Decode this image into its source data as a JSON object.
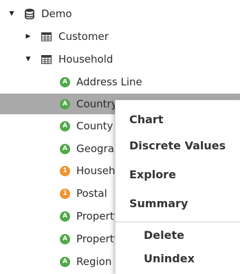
{
  "tree": {
    "root": {
      "label": "Demo",
      "icon": "database-icon",
      "expanded": true
    },
    "tables": [
      {
        "label": "Customer",
        "icon": "table-icon",
        "expanded": false
      },
      {
        "label": "Household",
        "icon": "table-icon",
        "expanded": true
      }
    ],
    "attributes": [
      {
        "label": "Address Line",
        "badge": "A",
        "color": "#51a84a"
      },
      {
        "label": "Country",
        "badge": "A",
        "color": "#51a84a",
        "selected": true
      },
      {
        "label": "County",
        "badge": "A",
        "color": "#51a84a"
      },
      {
        "label": "Geography",
        "badge": "A",
        "color": "#51a84a"
      },
      {
        "label": "Household",
        "badge": "1",
        "color": "#ef9430"
      },
      {
        "label": "Postal",
        "badge": "1",
        "color": "#ef9430"
      },
      {
        "label": "Property",
        "badge": "A",
        "color": "#51a84a"
      },
      {
        "label": "Property",
        "badge": "A",
        "color": "#51a84a"
      },
      {
        "label": "Region",
        "badge": "A",
        "color": "#51a84a"
      }
    ]
  },
  "context_menu": {
    "items": [
      {
        "label": "Chart"
      },
      {
        "label": "Discrete Values"
      },
      {
        "label": "Explore"
      },
      {
        "label": "Summary"
      }
    ],
    "secondary_items": [
      {
        "label": "Delete"
      },
      {
        "label": "Unindex"
      }
    ]
  },
  "colors": {
    "selected_row": "#a9a9a9",
    "attribute_green": "#51a84a",
    "attribute_orange": "#ef9430"
  }
}
